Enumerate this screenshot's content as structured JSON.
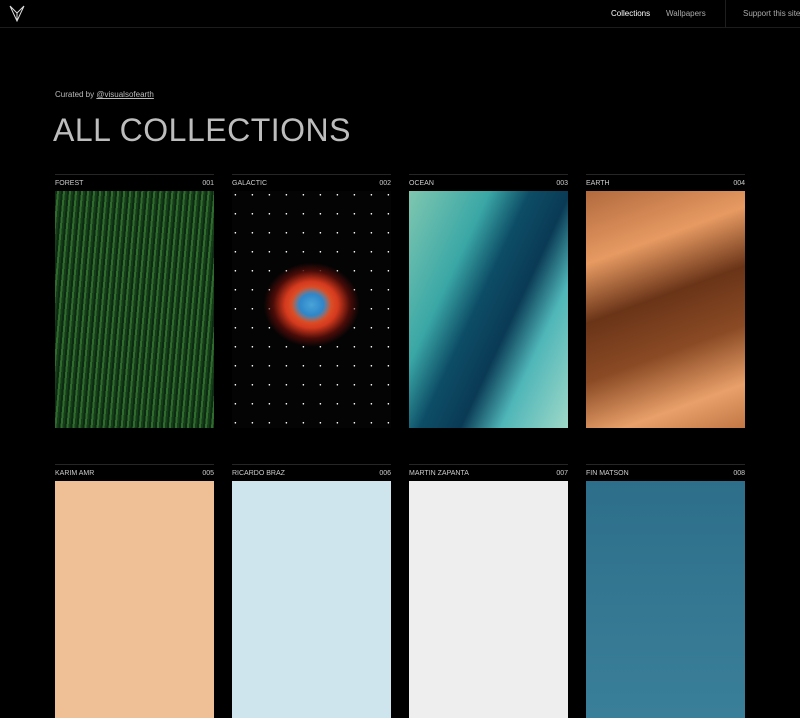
{
  "nav": {
    "links": [
      {
        "label": "Collections",
        "active": true
      },
      {
        "label": "Wallpapers"
      }
    ],
    "support": "Support this site"
  },
  "header": {
    "curated_prefix": "Curated by",
    "curator": "@visualsofearth",
    "title": "ALL COLLECTIONS"
  },
  "collections": [
    {
      "name": "FOREST",
      "num": "001"
    },
    {
      "name": "GALACTIC",
      "num": "002"
    },
    {
      "name": "OCEAN",
      "num": "003"
    },
    {
      "name": "EARTH",
      "num": "004"
    },
    {
      "name": "KARIM AMR",
      "num": "005"
    },
    {
      "name": "RICARDO BRAZ",
      "num": "006"
    },
    {
      "name": "MARTIN ZAPANTA",
      "num": "007"
    },
    {
      "name": "FIN MATSON",
      "num": "008"
    }
  ]
}
